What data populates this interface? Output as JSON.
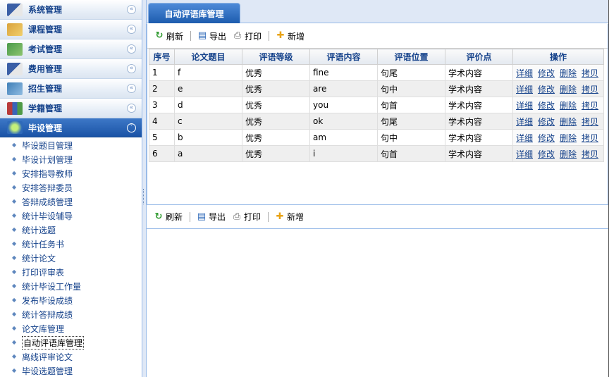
{
  "sidebar": {
    "groups": [
      {
        "label": "系统管理",
        "icon": "system-icon"
      },
      {
        "label": "课程管理",
        "icon": "course-box-icon"
      },
      {
        "label": "考试管理",
        "icon": "exam-book-icon"
      },
      {
        "label": "费用管理",
        "icon": "fee-icon"
      },
      {
        "label": "招生管理",
        "icon": "enrollment-icon"
      },
      {
        "label": "学籍管理",
        "icon": "student-records-icon"
      }
    ],
    "active_group": {
      "label": "毕设管理",
      "icon": "graduation-project-icon"
    },
    "items": [
      "毕设题目管理",
      "毕设计划管理",
      "安排指导教师",
      "安排答辩委员",
      "答辩成绩管理",
      "统计毕设辅导",
      "统计选题",
      "统计任务书",
      "统计论文",
      "打印评审表",
      "统计毕设工作量",
      "发布毕设成绩",
      "统计答辩成绩",
      "论文库管理",
      "自动评语库管理",
      "离线评审论文",
      "毕设选题管理"
    ],
    "current_item_index": 14
  },
  "tab": {
    "label": "自动评语库管理"
  },
  "toolbar": {
    "refresh": "刷新",
    "export": "导出",
    "print": "打印",
    "add": "新增"
  },
  "table": {
    "headers": [
      "序号",
      "论文题目",
      "评语等级",
      "评语内容",
      "评语位置",
      "评价点",
      "操作"
    ],
    "rows": [
      [
        "1",
        "f",
        "优秀",
        "fine",
        "句尾",
        "学术内容"
      ],
      [
        "2",
        "e",
        "优秀",
        "are",
        "句中",
        "学术内容"
      ],
      [
        "3",
        "d",
        "优秀",
        "you",
        "句首",
        "学术内容"
      ],
      [
        "4",
        "c",
        "优秀",
        "ok",
        "句尾",
        "学术内容"
      ],
      [
        "5",
        "b",
        "优秀",
        "am",
        "句中",
        "学术内容"
      ],
      [
        "6",
        "a",
        "优秀",
        "i",
        "句首",
        "学术内容"
      ]
    ],
    "actions": [
      "详细",
      "修改",
      "删除",
      "拷贝"
    ]
  }
}
